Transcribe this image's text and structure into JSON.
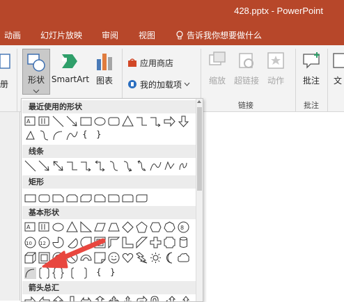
{
  "window": {
    "title": "428.pptx - PowerPoint"
  },
  "tabs": [
    {
      "label": "动画"
    },
    {
      "label": "幻灯片放映"
    },
    {
      "label": "审阅"
    },
    {
      "label": "视图"
    }
  ],
  "tell_me": "告诉我你想要做什么",
  "ribbon": {
    "partial_left": "册",
    "shapes": "形状",
    "smartart": "SmartArt",
    "chart": "图表",
    "store": "应用商店",
    "myaddins": "我的加载项",
    "zoom": "缩放",
    "hyperlink": "超链接",
    "action": "动作",
    "comment": "批注",
    "text_partial": "文",
    "group_links": "链接",
    "group_comments": "批注"
  },
  "shapes_panel": {
    "sections": [
      {
        "title": "最近使用的形状"
      },
      {
        "title": "线条"
      },
      {
        "title": "矩形"
      },
      {
        "title": "基本形状"
      },
      {
        "title": "箭头总汇"
      }
    ],
    "glyphs": {
      "brace_open": "{",
      "brace_close": "}"
    }
  },
  "colors": {
    "brand": "#b7472a",
    "arrow": "#e8473f"
  }
}
